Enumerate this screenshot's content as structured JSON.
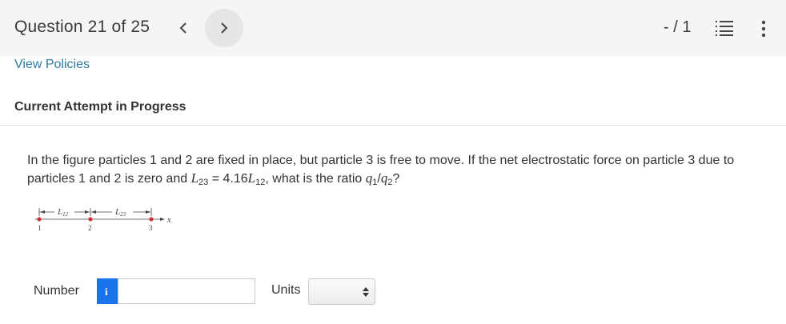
{
  "header": {
    "question_counter": "Question 21 of 25",
    "score": "- / 1"
  },
  "links": {
    "view_policies": "View Policies"
  },
  "section": {
    "title": "Current Attempt in Progress"
  },
  "question": {
    "part1": "In the figure particles 1 and 2 are fixed in place, but particle 3 is free to move. If the net electrostatic force on particle 3 due to particles 1 and 2 is zero and ",
    "L23_symbol": "L",
    "L23_sub": "23",
    "equals": " = 4.16",
    "L12_symbol": "L",
    "L12_sub": "12",
    "part2": ", what is the ratio ",
    "q1_symbol": "q",
    "q1_sub": "1",
    "slash": "/",
    "q2_symbol": "q",
    "q2_sub": "2",
    "part3": "?"
  },
  "figure": {
    "label_L12": "L",
    "label_L12_sub": "12",
    "label_L23": "L",
    "label_L23_sub": "23",
    "axis_label": "x",
    "particle_labels": [
      "1",
      "2",
      "3"
    ],
    "particle_color": "#d0312d"
  },
  "answer": {
    "number_label": "Number",
    "info_icon_glyph": "i",
    "input_value": "",
    "input_placeholder": "",
    "units_label": "Units",
    "units_selected": ""
  },
  "colors": {
    "link": "#2d7ba6",
    "info_button": "#1a73e8",
    "topbar_bg": "#f5f5f5"
  },
  "icons": [
    "chevron-left-icon",
    "chevron-right-icon",
    "list-icon",
    "more-vertical-icon",
    "info-icon",
    "select-arrows-icon"
  ]
}
